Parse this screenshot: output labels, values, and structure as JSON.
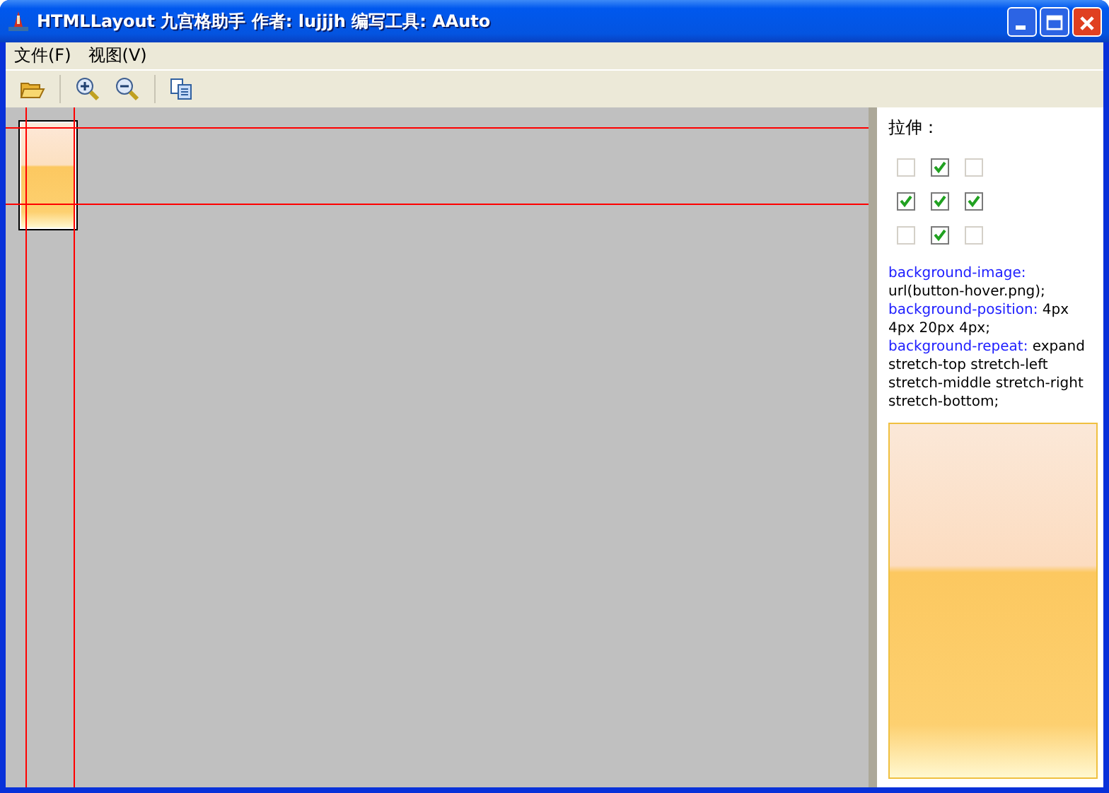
{
  "window": {
    "title": "HTMLLayout 九宫格助手  作者: lujjjh  编写工具: AAuto"
  },
  "menu": [
    {
      "label": "文件",
      "accel": "(F)"
    },
    {
      "label": "视图",
      "accel": "(V)"
    }
  ],
  "stretch": {
    "label": "拉伸：",
    "grid": [
      {
        "checked": false
      },
      {
        "checked": true
      },
      {
        "checked": false
      },
      {
        "checked": true
      },
      {
        "checked": true
      },
      {
        "checked": true
      },
      {
        "checked": false
      },
      {
        "checked": true
      },
      {
        "checked": false
      }
    ]
  },
  "css": [
    {
      "property": "background-image:",
      "value": "url(button-hover.png);"
    },
    {
      "property": "background-position:",
      "value": "4px 4px 20px 4px;"
    },
    {
      "property": "background-repeat:",
      "value": "expand stretch-top stretch-left stretch-middle stretch-right stretch-bottom;"
    }
  ]
}
